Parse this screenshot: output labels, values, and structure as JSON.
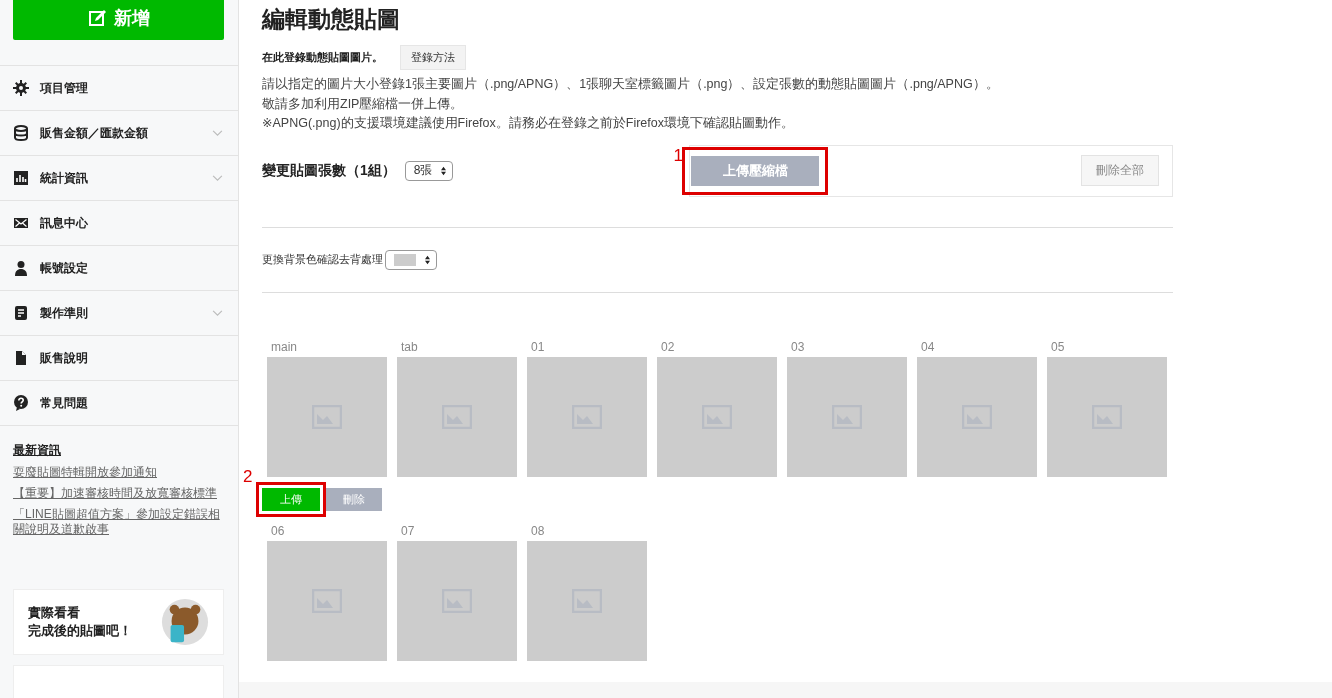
{
  "sidebar": {
    "new_button": "新增",
    "items": [
      {
        "label": "項目管理",
        "expandable": false
      },
      {
        "label": "販售金額／匯款金額",
        "expandable": true
      },
      {
        "label": "統計資訊",
        "expandable": true
      },
      {
        "label": "訊息中心",
        "expandable": false
      },
      {
        "label": "帳號設定",
        "expandable": false
      },
      {
        "label": "製作準則",
        "expandable": true
      },
      {
        "label": "販售說明",
        "expandable": false
      },
      {
        "label": "常見問題",
        "expandable": false
      }
    ],
    "news": {
      "title": "最新資訊",
      "links": [
        "耍廢貼圖特輯開放參加通知",
        "【重要】加速審核時間及放寬審核標準",
        "「LINE貼圖超值方案」參加設定錯誤相關說明及道歉啟事"
      ]
    },
    "banner": {
      "lines": [
        "實際看看",
        "完成後的貼圖吧！"
      ]
    }
  },
  "main": {
    "title": "編輯動態貼圖",
    "intro": "在此登錄動態貼圖圖片。",
    "how_button": "登錄方法",
    "notes": [
      "請以指定的圖片大小登錄1張主要圖片（.png/APNG）、1張聊天室標籤圖片（.png）、設定張數的動態貼圖圖片（.png/APNG）。",
      "敬請多加利用ZIP壓縮檔一併上傳。",
      "※APNG(.png)的支援環境建議使用Firefox。請務必在登錄之前於Firefox環境下確認貼圖動作。"
    ],
    "count_label": "變更貼圖張數（1組）",
    "count_select": "8張",
    "upload_zip": {
      "label": "上傳壓縮檔",
      "annotation": "1"
    },
    "delete_all": "刪除全部",
    "bg_label": "更換背景色確認去背處理",
    "sticker_rows": [
      {
        "stickers": [
          {
            "label": "main"
          },
          {
            "label": "tab"
          },
          {
            "label": "01"
          },
          {
            "label": "02"
          },
          {
            "label": "03"
          },
          {
            "label": "04"
          },
          {
            "label": "05"
          }
        ],
        "actions": {
          "upload": "上傳",
          "delete": "刪除",
          "annotation": "2"
        }
      },
      {
        "stickers": [
          {
            "label": "06"
          },
          {
            "label": "07"
          },
          {
            "label": "08"
          }
        ]
      }
    ]
  }
}
